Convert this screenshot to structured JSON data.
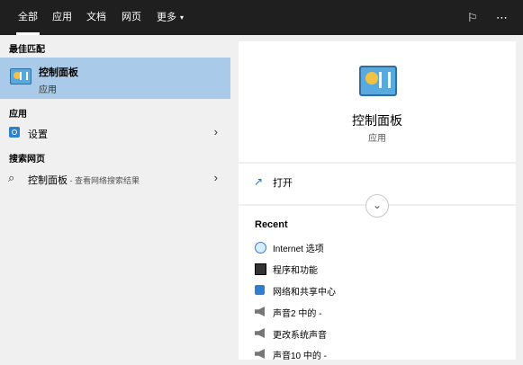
{
  "topbar": {
    "tabs": [
      {
        "label": "全部"
      },
      {
        "label": "应用"
      },
      {
        "label": "文档"
      },
      {
        "label": "网页"
      },
      {
        "label": "更多"
      }
    ],
    "more_caret": "▾",
    "feedback_icon": "feedback-icon",
    "more_options_icon": "ellipsis-icon"
  },
  "left": {
    "best_match_header": "最佳匹配",
    "best_match": {
      "title": "控制面板",
      "subtitle": "应用",
      "icon": "control-panel-icon"
    },
    "apps_header": "应用",
    "apps": [
      {
        "label": "设置",
        "icon": "gear-icon"
      }
    ],
    "web_header": "搜索网页",
    "web": [
      {
        "label": "控制面板",
        "hint": " - 查看网络搜索结果",
        "icon": "search-icon"
      }
    ]
  },
  "right": {
    "title": "控制面板",
    "subtitle": "应用",
    "open_label": "打开",
    "recent_header": "Recent",
    "recent": [
      {
        "label": "Internet 选项",
        "icon": "globe-icon"
      },
      {
        "label": "程序和功能",
        "icon": "programs-icon"
      },
      {
        "label": "网络和共享中心",
        "icon": "network-icon"
      },
      {
        "label": "声音2 中的 -",
        "icon": "speaker-icon"
      },
      {
        "label": "更改系统声音",
        "icon": "speaker-icon"
      },
      {
        "label": "声音10 中的 -",
        "icon": "speaker-icon"
      }
    ]
  },
  "colors": {
    "topbar": "#1f1f1f",
    "selected": "#a9cbe9",
    "panel": "#f0f0f0",
    "accent": "#2f7fd0"
  }
}
